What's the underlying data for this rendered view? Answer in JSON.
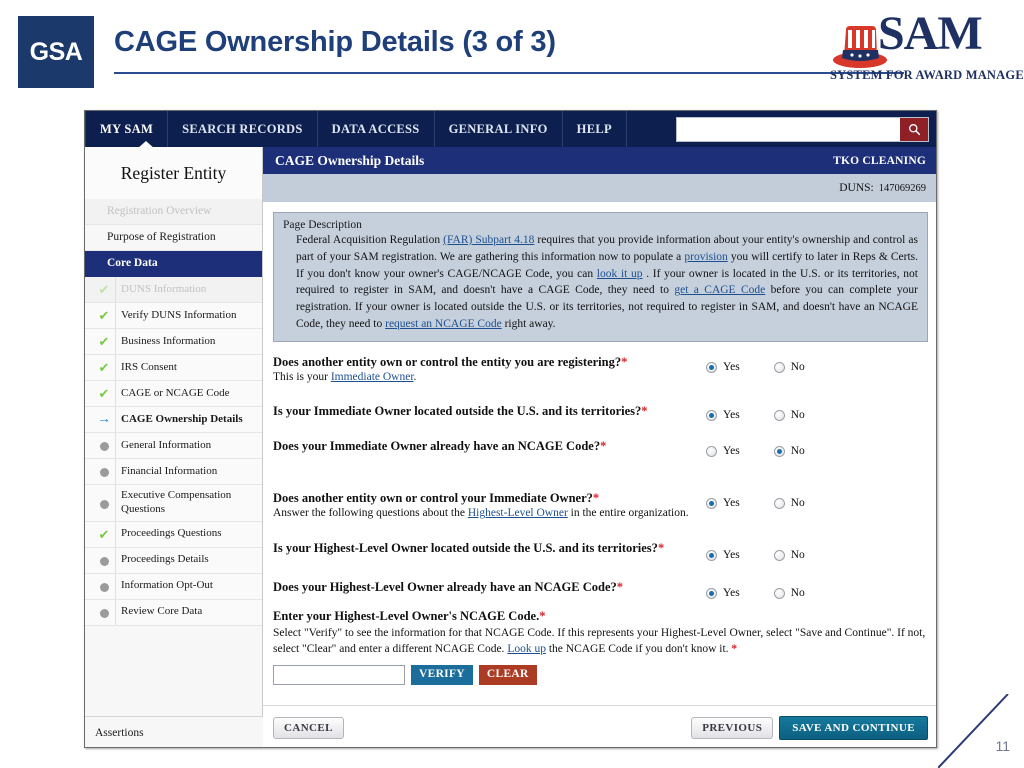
{
  "slide": {
    "title": "CAGE Ownership Details (3 of 3)",
    "page_number": "11",
    "gsa_logo_text": "GSA",
    "sam_logo_word": "SAM",
    "sam_logo_tagline": "SYSTEM FOR AWARD MANAGEMENT",
    "accent_navy": "#1f3f7a",
    "gsa_blue": "#1b3a6b"
  },
  "nav": {
    "items": [
      {
        "label": "MY SAM",
        "active": true
      },
      {
        "label": "SEARCH RECORDS",
        "active": false
      },
      {
        "label": "DATA ACCESS",
        "active": false
      },
      {
        "label": "GENERAL INFO",
        "active": false
      },
      {
        "label": "HELP",
        "active": false
      }
    ],
    "search": {
      "value": "",
      "placeholder": "",
      "icon": "search-icon"
    }
  },
  "sidebar": {
    "title": "Register Entity",
    "items": [
      {
        "label": "Registration Overview",
        "state": "disabled",
        "marker": "none",
        "level": "top"
      },
      {
        "label": "Purpose of Registration",
        "state": "normal",
        "marker": "none",
        "level": "top"
      },
      {
        "label": "Core Data",
        "state": "active",
        "marker": "none",
        "level": "top"
      },
      {
        "label": "DUNS Information",
        "state": "disabled",
        "marker": "check-dim",
        "level": "sub"
      },
      {
        "label": "Verify DUNS Information",
        "state": "normal",
        "marker": "check",
        "level": "sub"
      },
      {
        "label": "Business Information",
        "state": "normal",
        "marker": "check",
        "level": "sub"
      },
      {
        "label": "IRS Consent",
        "state": "normal",
        "marker": "check",
        "level": "sub"
      },
      {
        "label": "CAGE or NCAGE Code",
        "state": "normal",
        "marker": "check",
        "level": "sub"
      },
      {
        "label": "CAGE Ownership Details",
        "state": "current",
        "marker": "arrow",
        "level": "sub"
      },
      {
        "label": "General Information",
        "state": "normal",
        "marker": "dot",
        "level": "sub"
      },
      {
        "label": "Financial Information",
        "state": "normal",
        "marker": "dot",
        "level": "sub"
      },
      {
        "label": "Executive Compensation Questions",
        "state": "normal",
        "marker": "dot",
        "level": "sub"
      },
      {
        "label": "Proceedings Questions",
        "state": "normal",
        "marker": "check",
        "level": "sub"
      },
      {
        "label": "Proceedings Details",
        "state": "normal",
        "marker": "dot",
        "level": "sub"
      },
      {
        "label": "Information Opt-Out",
        "state": "normal",
        "marker": "dot",
        "level": "sub"
      },
      {
        "label": "Review Core Data",
        "state": "normal",
        "marker": "dot",
        "level": "sub"
      }
    ],
    "footer_item": "Assertions"
  },
  "content": {
    "header_title": "CAGE Ownership Details",
    "entity_name": "TKO CLEANING",
    "duns_label": "DUNS:",
    "duns_value": "147069269",
    "page_description": {
      "label": "Page Description",
      "segments": [
        {
          "t": "Federal Acquisition Regulation ",
          "link": false
        },
        {
          "t": "(FAR) Subpart 4.18",
          "link": true
        },
        {
          "t": " requires that you provide information about your entity's ownership and control as part of your SAM registration. We are gathering this information now to populate a ",
          "link": false
        },
        {
          "t": "provision",
          "link": true
        },
        {
          "t": " you will certify to later in Reps & Certs. If you don't know your owner's CAGE/NCAGE Code, you can ",
          "link": false
        },
        {
          "t": "look it up",
          "link": true
        },
        {
          "t": " . If your owner is located in the U.S. or its territories, not required to register in SAM, and doesn't have a CAGE Code, they need to ",
          "link": false
        },
        {
          "t": "get a CAGE Code",
          "link": true
        },
        {
          "t": " before you can complete your registration. If your owner is located outside the U.S. or its territories, not required to register in SAM, and doesn't have an NCAGE Code, they need to ",
          "link": false
        },
        {
          "t": "request an NCAGE Code",
          "link": true
        },
        {
          "t": " right away.",
          "link": false
        }
      ]
    },
    "questions": [
      {
        "id": "q1",
        "title": "Does another entity own or control the entity you are registering?",
        "required": true,
        "sub_segments": [
          {
            "t": "This is your  ",
            "link": false
          },
          {
            "t": "Immediate Owner",
            "link": true
          },
          {
            "t": ".",
            "link": false
          }
        ],
        "options": [
          {
            "label": "Yes",
            "selected": true
          },
          {
            "label": "No",
            "selected": false
          }
        ]
      },
      {
        "id": "q2",
        "title": "Is your Immediate Owner located outside the U.S. and its territories?",
        "required": true,
        "sub_segments": [],
        "options": [
          {
            "label": "Yes",
            "selected": true
          },
          {
            "label": "No",
            "selected": false
          }
        ]
      },
      {
        "id": "q3",
        "title": "Does your Immediate Owner already have an NCAGE Code?",
        "required": true,
        "sub_segments": [],
        "options": [
          {
            "label": "Yes",
            "selected": false
          },
          {
            "label": "No",
            "selected": true
          }
        ]
      },
      {
        "id": "q4",
        "title": "Does another entity own or control your Immediate Owner?",
        "required": true,
        "sub_segments": [
          {
            "t": "Answer the following questions about the  ",
            "link": false
          },
          {
            "t": "Highest-Level Owner",
            "link": true
          },
          {
            "t": " in the entire organization.",
            "link": false
          }
        ],
        "options": [
          {
            "label": "Yes",
            "selected": true
          },
          {
            "label": "No",
            "selected": false
          }
        ]
      },
      {
        "id": "q5",
        "title": "Is your Highest-Level Owner located outside the U.S. and its territories?",
        "required": true,
        "sub_segments": [],
        "options": [
          {
            "label": "Yes",
            "selected": true
          },
          {
            "label": "No",
            "selected": false
          }
        ]
      },
      {
        "id": "q6",
        "title": "Does your Highest-Level Owner already have an NCAGE Code?",
        "required": true,
        "sub_segments": [],
        "options": [
          {
            "label": "Yes",
            "selected": true
          },
          {
            "label": "No",
            "selected": false
          }
        ]
      }
    ],
    "ncage_entry": {
      "title": "Enter your Highest-Level Owner's NCAGE Code.",
      "required": true,
      "help_segments": [
        {
          "t": "Select \"Verify\" to see the information for that NCAGE Code. If this represents your Highest-Level Owner, select \"Save and Continue\". If not, select \"Clear\" and enter a different NCAGE Code.  ",
          "link": false
        },
        {
          "t": "Look up",
          "link": true
        },
        {
          "t": " the NCAGE Code if you don't know it. ",
          "link": false
        }
      ],
      "input_value": "",
      "input_placeholder": "",
      "verify_label": "VERIFY",
      "clear_label": "CLEAR"
    },
    "footer": {
      "cancel_label": "CANCEL",
      "previous_label": "PREVIOUS",
      "save_label": "SAVE AND CONTINUE"
    }
  }
}
